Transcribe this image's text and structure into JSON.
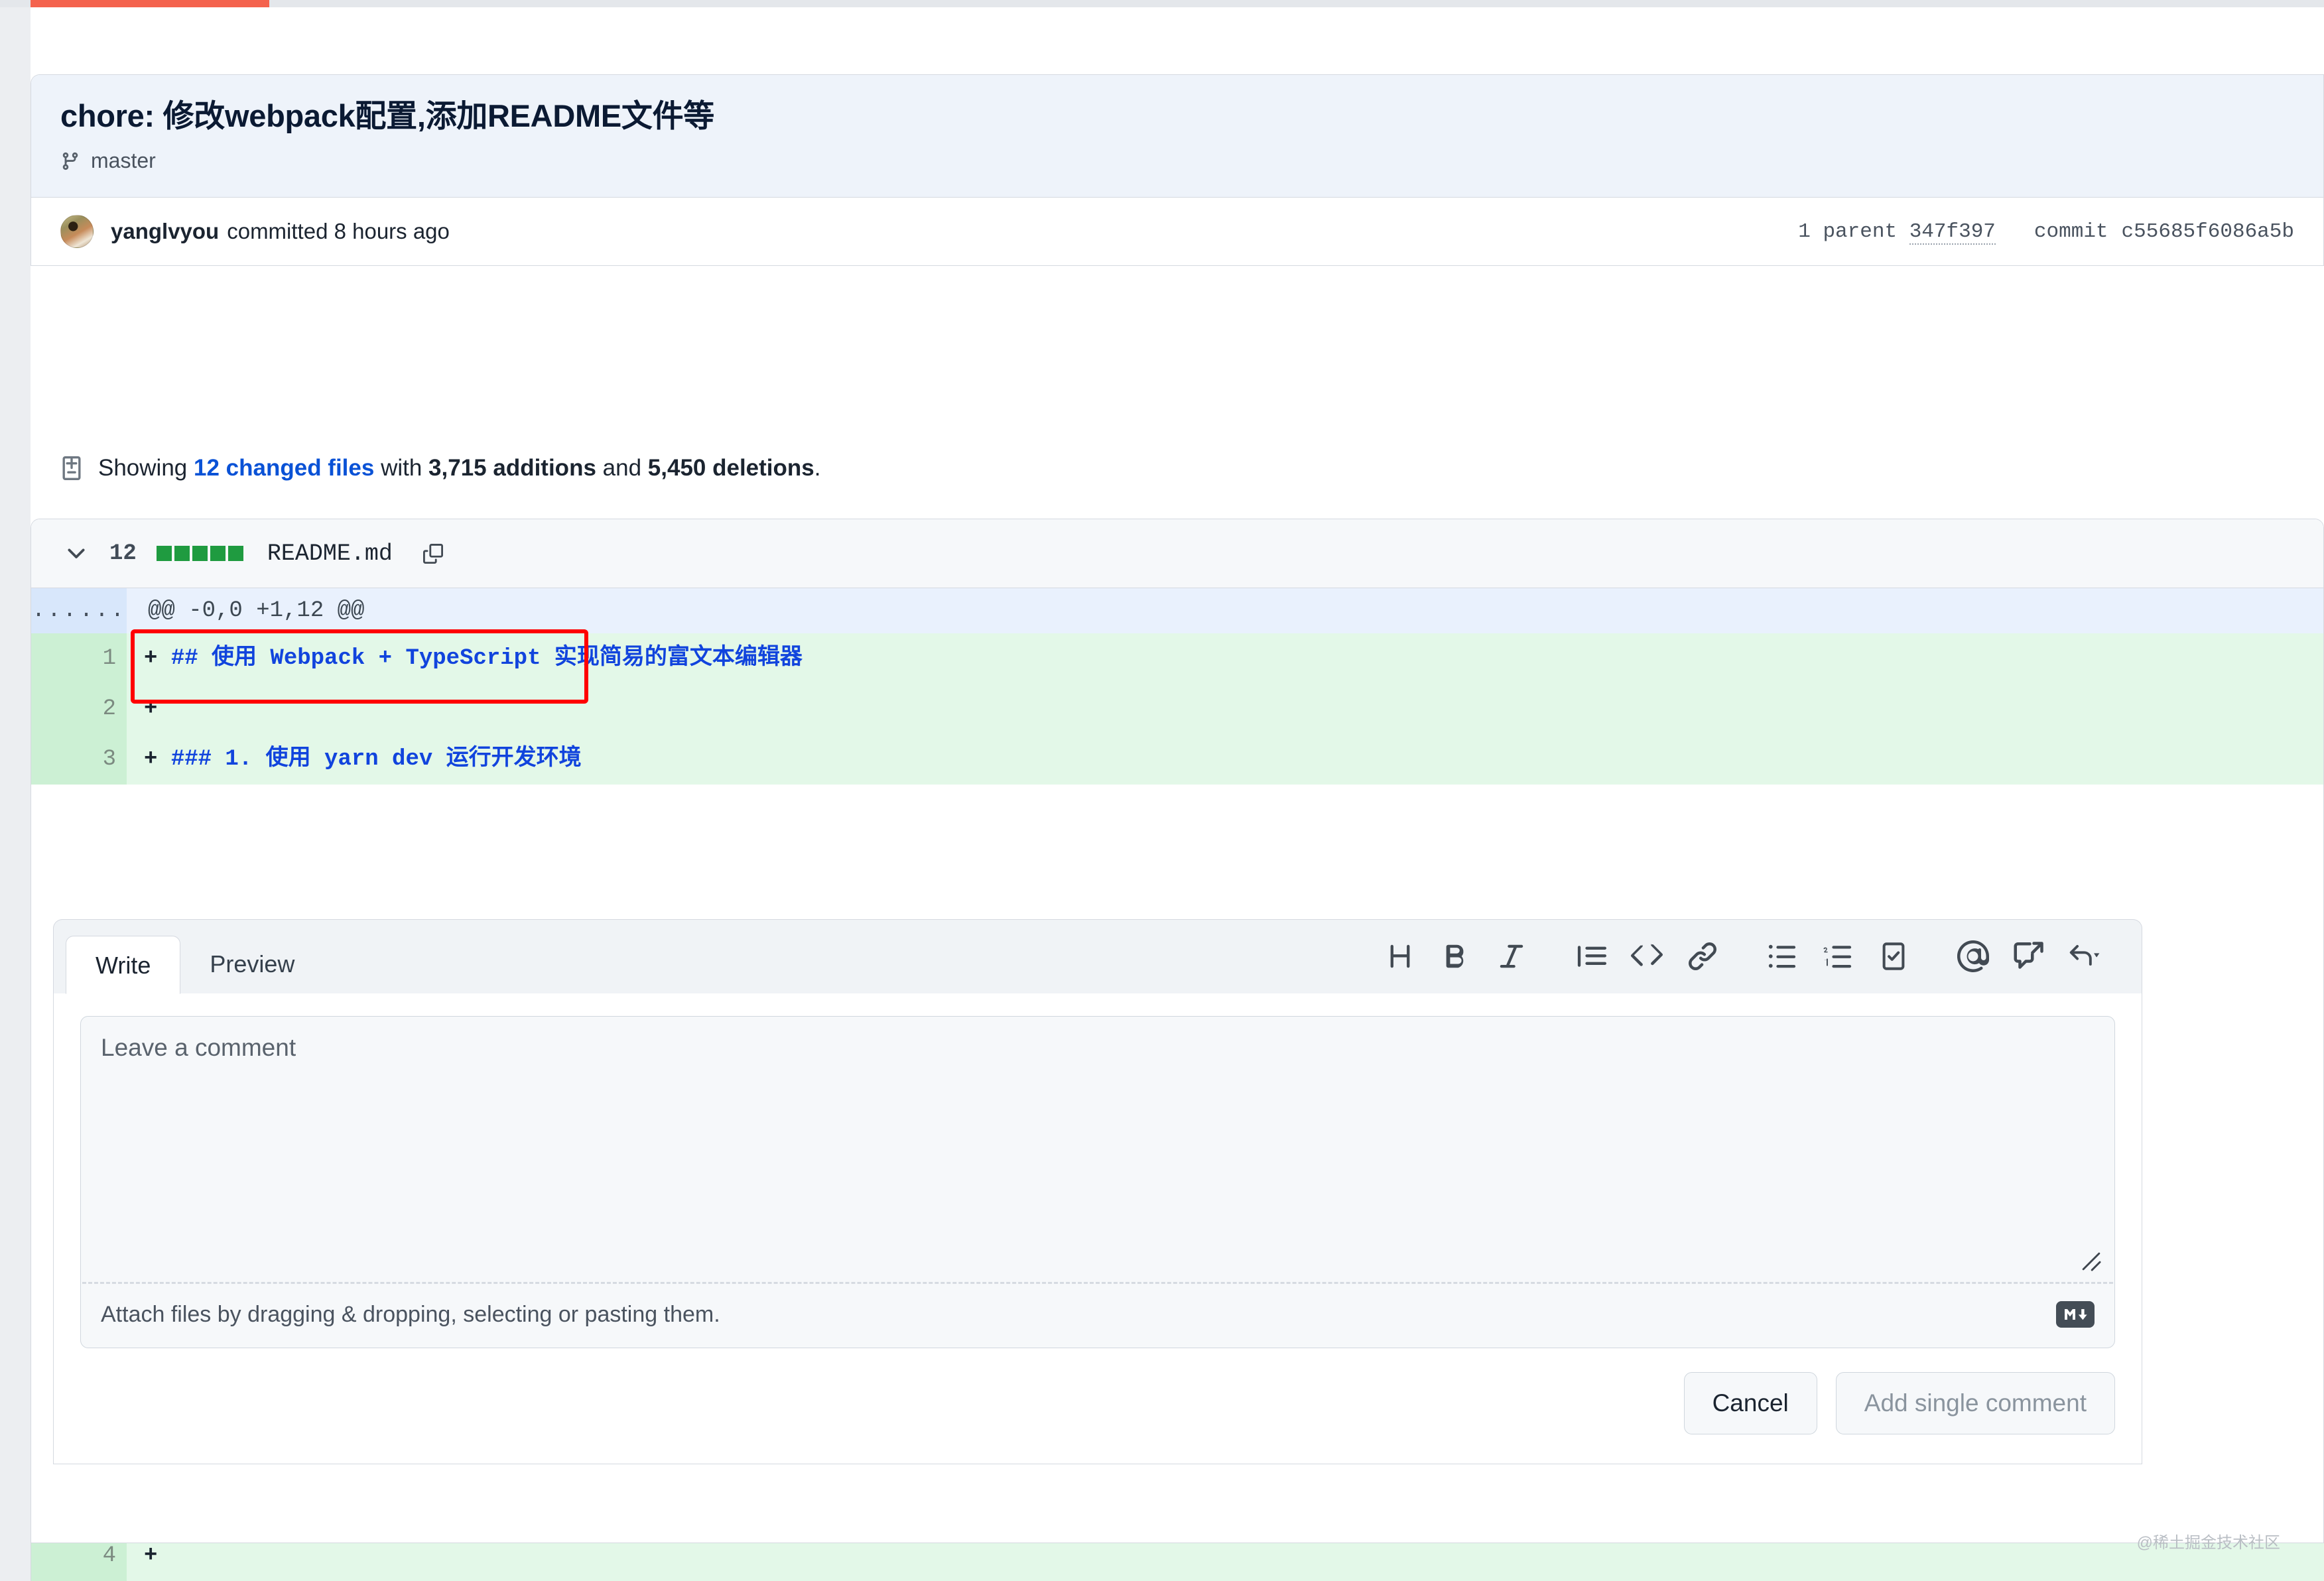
{
  "loading": {
    "progress_label": "page-loading-bar"
  },
  "commit": {
    "title": "chore: 修改webpack配置,添加README文件等",
    "branch": "master",
    "author": "yanglvyou",
    "committed_text": "committed 8 hours ago",
    "parent_label": "1 parent",
    "parent_hash": "347f397",
    "commit_label": "commit",
    "commit_hash": "c55685f6086a5b"
  },
  "summary": {
    "showing": "Showing",
    "changed_files": "12 changed files",
    "with": "with",
    "additions": "3,715 additions",
    "and": "and",
    "deletions": "5,450 deletions",
    "period": "."
  },
  "file": {
    "change_count": "12",
    "stat_blocks": 5,
    "name": "README.md",
    "hunk_header": "@@ -0,0 +1,12 @@",
    "gutter_dots": "...",
    "lines": [
      {
        "num": "1",
        "marker": "+",
        "text": "## 使用 Webpack + TypeScript 实现简易的富文本编辑器"
      },
      {
        "num": "2",
        "marker": "+",
        "text": ""
      },
      {
        "num": "3",
        "marker": "+",
        "text": "### 1. 使用 yarn dev 运行开发环境"
      }
    ],
    "bottom_line": {
      "num": "4",
      "marker": "+",
      "text": ""
    }
  },
  "comment_form": {
    "tabs": [
      {
        "label": "Write",
        "active": true
      },
      {
        "label": "Preview",
        "active": false
      }
    ],
    "toolbar": [
      {
        "name": "heading-icon",
        "title": "Add heading text"
      },
      {
        "name": "bold-icon",
        "title": "Add bold text"
      },
      {
        "name": "italic-icon",
        "title": "Add italic text"
      },
      {
        "name": "quote-icon",
        "title": "Add a quote"
      },
      {
        "name": "code-icon",
        "title": "Add code"
      },
      {
        "name": "link-icon",
        "title": "Add a link"
      },
      {
        "name": "unordered-list-icon",
        "title": "Add a bulleted list"
      },
      {
        "name": "ordered-list-icon",
        "title": "Add a numbered list"
      },
      {
        "name": "task-list-icon",
        "title": "Add a task list"
      },
      {
        "name": "mention-icon",
        "title": "Directly mention a user or team"
      },
      {
        "name": "reference-icon",
        "title": "Reference an issue or pull request"
      },
      {
        "name": "saved-replies-icon",
        "title": "Add saved reply"
      }
    ],
    "textarea_placeholder": "Leave a comment",
    "textarea_value": "",
    "attach_hint": "Attach files by dragging & dropping, selecting or pasting them.",
    "markdown_badge": "MD",
    "cancel_label": "Cancel",
    "submit_label": "Add single comment",
    "submit_disabled": true
  },
  "watermark": "@稀土掘金技术社区",
  "colors": {
    "accent_blue": "#0a52d6",
    "diff_add_bg": "#e3f8e8",
    "diff_add_gutter": "#ccf0d4",
    "hunk_bg": "#e9f1fd",
    "hunk_gutter": "#d8e7fb",
    "header_bg": "#eef3fa",
    "annotation_red": "#ff0000",
    "loading_red": "#f4624d",
    "diff_text_blue": "#1144dd",
    "stat_green": "#1f9b40"
  }
}
